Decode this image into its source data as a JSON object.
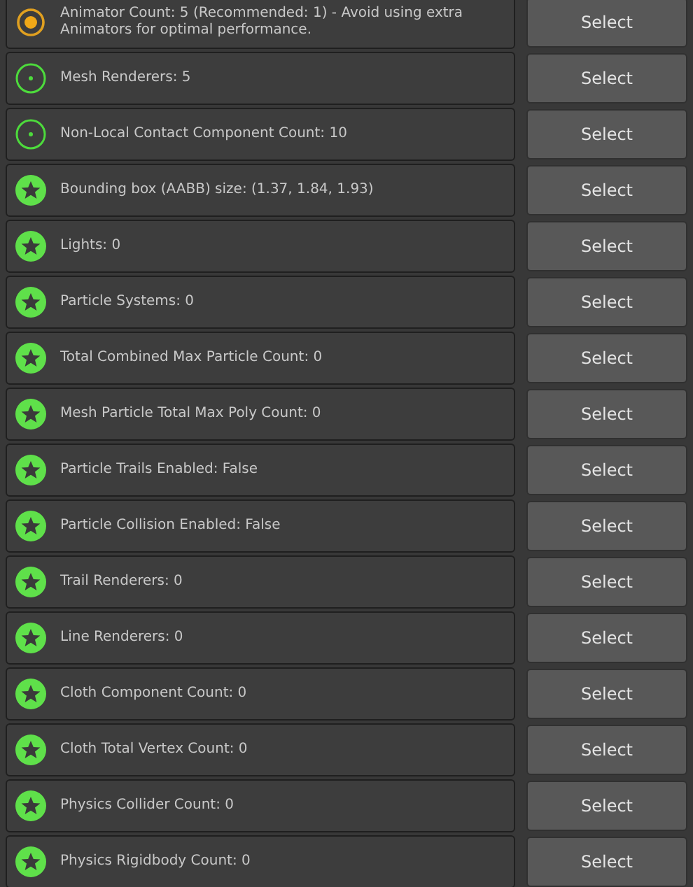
{
  "rows": [
    {
      "kind": "warning",
      "text": "Animator Count: 5 (Recommended: 1) - Avoid using extra Animators for optimal performance.",
      "button": "Select"
    },
    {
      "kind": "info",
      "text": "Mesh Renderers: 5",
      "button": "Select"
    },
    {
      "kind": "info",
      "text": "Non-Local Contact Component Count: 10",
      "button": "Select"
    },
    {
      "kind": "excellent",
      "text": "Bounding box (AABB) size: (1.37, 1.84, 1.93)",
      "button": "Select"
    },
    {
      "kind": "excellent",
      "text": "Lights: 0",
      "button": "Select"
    },
    {
      "kind": "excellent",
      "text": "Particle Systems: 0",
      "button": "Select"
    },
    {
      "kind": "excellent",
      "text": "Total Combined Max Particle Count: 0",
      "button": "Select"
    },
    {
      "kind": "excellent",
      "text": "Mesh Particle Total Max Poly Count: 0",
      "button": "Select"
    },
    {
      "kind": "excellent",
      "text": "Particle Trails Enabled: False",
      "button": "Select"
    },
    {
      "kind": "excellent",
      "text": "Particle Collision Enabled: False",
      "button": "Select"
    },
    {
      "kind": "excellent",
      "text": "Trail Renderers: 0",
      "button": "Select"
    },
    {
      "kind": "excellent",
      "text": "Line Renderers: 0",
      "button": "Select"
    },
    {
      "kind": "excellent",
      "text": "Cloth Component Count: 0",
      "button": "Select"
    },
    {
      "kind": "excellent",
      "text": "Cloth Total Vertex Count: 0",
      "button": "Select"
    },
    {
      "kind": "excellent",
      "text": "Physics Collider Count: 0",
      "button": "Select"
    },
    {
      "kind": "excellent",
      "text": "Physics Rigidbody Count: 0",
      "button": "Select"
    }
  ]
}
